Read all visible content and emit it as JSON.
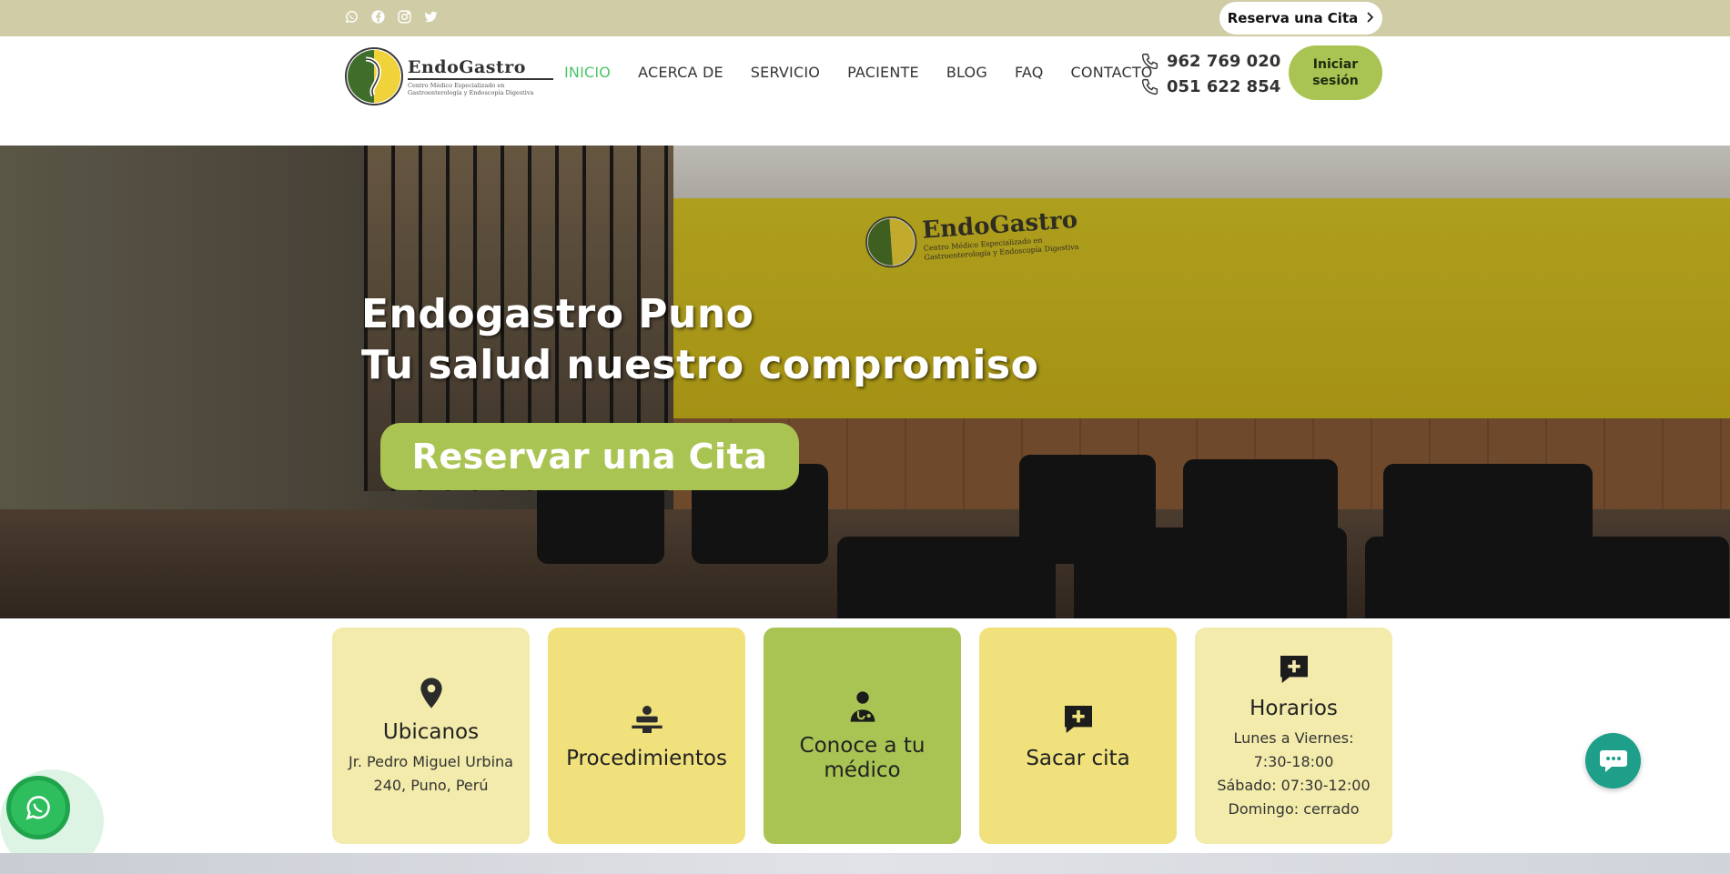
{
  "topbar": {
    "social": [
      "whatsapp-icon",
      "facebook-icon",
      "instagram-icon",
      "twitter-icon"
    ],
    "reserve_label": "Reserva una Cita"
  },
  "header": {
    "logo": {
      "name": "EndoGastro",
      "subtitle": "Centro Médico Especializado en Gastroenterología y Endoscopía Digestiva"
    },
    "nav": [
      "INICIO",
      "ACERCA DE",
      "SERVICIO",
      "PACIENTE",
      "BLOG",
      "FAQ",
      "CONTACTO"
    ],
    "active_nav": "INICIO",
    "phones": [
      "962 769 020",
      "051 622 854"
    ],
    "login_label": "Iniciar sesión"
  },
  "hero": {
    "title_line1": "Endogastro Puno",
    "title_line2": "Tu salud nuestro compromiso",
    "cta_label": "Reservar una Cita"
  },
  "cards": [
    {
      "title": "Ubicanos",
      "text": "Jr. Pedro Miguel Urbina 240, Puno, Perú",
      "icon": "location-pin-icon"
    },
    {
      "title": "Procedimientos",
      "text": "",
      "icon": "procedure-icon"
    },
    {
      "title": "Conoce a tu médico",
      "text": "",
      "icon": "doctor-icon"
    },
    {
      "title": "Sacar cita",
      "text": "",
      "icon": "medical-chat-icon"
    },
    {
      "title": "Horarios",
      "lines": [
        "Lunes a Viernes:",
        "7:30-18:00",
        "Sábado: 07:30-12:00",
        "Domingo: cerrado"
      ],
      "icon": "medical-chat-icon"
    }
  ],
  "colors": {
    "topbar": "#cfcca6",
    "accent_green": "#a9c453",
    "nav_active": "#4cc468",
    "card_light": "#f3ebab",
    "card_mid": "#f0e17d",
    "whatsapp": "#2fbe5e",
    "chat": "#1d9f8a"
  }
}
